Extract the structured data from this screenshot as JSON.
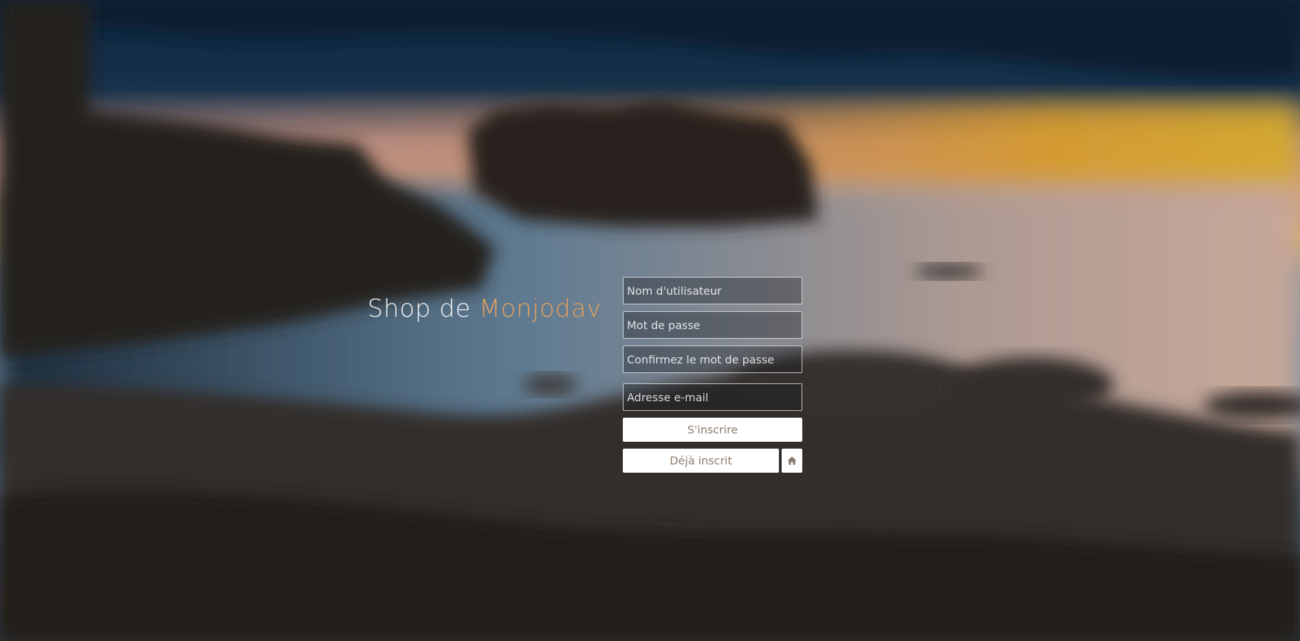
{
  "header": {
    "title_prefix": "Shop de ",
    "title_accent": "Monjodav"
  },
  "form": {
    "username_placeholder": "Nom d'utilisateur",
    "password_placeholder": "Mot de passe",
    "confirm_password_placeholder": "Confirmez le mot de passe",
    "email_placeholder": "Adresse e-mail",
    "signup_label": "S'inscrire",
    "already_registered_label": "Déjà inscrit",
    "home_icon": "home-icon"
  },
  "colors": {
    "accent": "#e3a15d",
    "button_text": "#8c7b6b"
  }
}
